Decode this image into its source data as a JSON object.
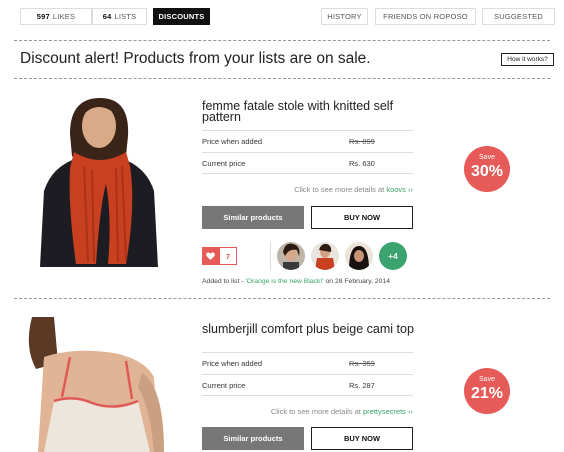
{
  "tabs": {
    "likes": {
      "count": "597",
      "label": "LIKES"
    },
    "lists": {
      "count": "64",
      "label": "LISTS"
    },
    "discounts": {
      "label": "DISCOUNTS"
    },
    "history": {
      "label": "HISTORY"
    },
    "friends": {
      "label": "FRIENDS ON ROPOSO"
    },
    "suggested": {
      "label": "SUGGESTED"
    }
  },
  "headline": "Discount alert! Products from your lists are on sale.",
  "how_it_works": "How it works?",
  "products": [
    {
      "title": "femme fatale stole with knitted self pattern",
      "price_added_label": "Price when added",
      "price_added": "Rs. 899",
      "current_label": "Current price",
      "current_price": "Rs. 630",
      "details_prefix": "Click to see more details at",
      "store": "koovs ››",
      "similar_label": "Similar products",
      "buy_label": "BUY NOW",
      "badge_label": "Save",
      "badge_pct": "30%",
      "likes": "7",
      "more_users": "+4",
      "added_prefix": "Added to list -",
      "list_name": "'Orange is the new Black!'",
      "added_date": "on 28 February, 2014",
      "image": "woman-orange-scarf"
    },
    {
      "title": "slumberjill comfort plus beige cami top",
      "price_added_label": "Price when added",
      "price_added": "Rs. 359",
      "current_label": "Current price",
      "current_price": "Rs. 287",
      "details_prefix": "Click to see more details at",
      "store": "prettysecrets ››",
      "similar_label": "Similar products",
      "buy_label": "BUY NOW",
      "badge_label": "Save",
      "badge_pct": "21%",
      "image": "woman-beige-cami"
    }
  ],
  "colors": {
    "accent_red": "#e65a57",
    "accent_green": "#3aa36e",
    "dark": "#111111"
  },
  "icons": [
    "heart-icon"
  ]
}
